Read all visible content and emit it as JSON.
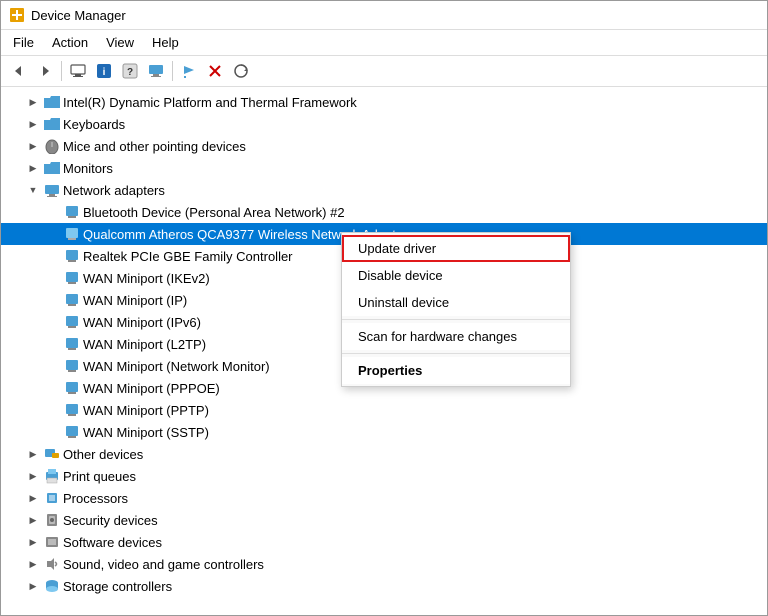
{
  "window": {
    "title": "Device Manager"
  },
  "menu": {
    "items": [
      "File",
      "Action",
      "View",
      "Help"
    ]
  },
  "toolbar": {
    "buttons": [
      {
        "name": "back",
        "icon": "◀",
        "disabled": false
      },
      {
        "name": "forward",
        "icon": "▶",
        "disabled": false
      },
      {
        "name": "computer",
        "icon": "🖥",
        "disabled": false
      },
      {
        "name": "info",
        "icon": "ℹ",
        "disabled": false
      },
      {
        "name": "help",
        "icon": "?",
        "disabled": false
      },
      {
        "name": "monitor",
        "icon": "🖥",
        "disabled": false
      },
      {
        "name": "flag",
        "icon": "⚑",
        "disabled": false
      },
      {
        "name": "delete",
        "icon": "✖",
        "disabled": false
      },
      {
        "name": "refresh",
        "icon": "⊕",
        "disabled": false
      }
    ]
  },
  "tree": {
    "items": [
      {
        "id": "intel",
        "label": "Intel(R) Dynamic Platform and Thermal Framework",
        "indent": 1,
        "icon": "folder",
        "expander": "collapsed"
      },
      {
        "id": "keyboards",
        "label": "Keyboards",
        "indent": 1,
        "icon": "folder",
        "expander": "collapsed"
      },
      {
        "id": "mice",
        "label": "Mice and other pointing devices",
        "indent": 1,
        "icon": "mouse",
        "expander": "collapsed"
      },
      {
        "id": "monitors",
        "label": "Monitors",
        "indent": 1,
        "icon": "folder",
        "expander": "collapsed"
      },
      {
        "id": "network",
        "label": "Network adapters",
        "indent": 1,
        "icon": "network",
        "expander": "expanded"
      },
      {
        "id": "bluetooth",
        "label": "Bluetooth Device (Personal Area Network) #2",
        "indent": 2,
        "icon": "network-device",
        "expander": "leaf"
      },
      {
        "id": "qualcomm",
        "label": "Qualcomm Atheros QCA9377 Wireless Network Adapter",
        "indent": 2,
        "icon": "network-device",
        "expander": "leaf",
        "selected": true
      },
      {
        "id": "realtek",
        "label": "Realtek PCIe GBE Family Controller",
        "indent": 2,
        "icon": "network-device",
        "expander": "leaf"
      },
      {
        "id": "wan-ikev2",
        "label": "WAN Miniport (IKEv2)",
        "indent": 2,
        "icon": "network-device",
        "expander": "leaf"
      },
      {
        "id": "wan-ip",
        "label": "WAN Miniport (IP)",
        "indent": 2,
        "icon": "network-device",
        "expander": "leaf"
      },
      {
        "id": "wan-ipv6",
        "label": "WAN Miniport (IPv6)",
        "indent": 2,
        "icon": "network-device",
        "expander": "leaf"
      },
      {
        "id": "wan-l2tp",
        "label": "WAN Miniport (L2TP)",
        "indent": 2,
        "icon": "network-device",
        "expander": "leaf"
      },
      {
        "id": "wan-nm",
        "label": "WAN Miniport (Network Monitor)",
        "indent": 2,
        "icon": "network-device",
        "expander": "leaf"
      },
      {
        "id": "wan-pppoe",
        "label": "WAN Miniport (PPPOE)",
        "indent": 2,
        "icon": "network-device",
        "expander": "leaf"
      },
      {
        "id": "wan-pptp",
        "label": "WAN Miniport (PPTP)",
        "indent": 2,
        "icon": "network-device",
        "expander": "leaf"
      },
      {
        "id": "wan-sstp",
        "label": "WAN Miniport (SSTP)",
        "indent": 2,
        "icon": "network-device",
        "expander": "leaf"
      },
      {
        "id": "other",
        "label": "Other devices",
        "indent": 1,
        "icon": "folder-device",
        "expander": "collapsed"
      },
      {
        "id": "print",
        "label": "Print queues",
        "indent": 1,
        "icon": "print",
        "expander": "collapsed"
      },
      {
        "id": "processors",
        "label": "Processors",
        "indent": 1,
        "icon": "folder",
        "expander": "collapsed"
      },
      {
        "id": "security",
        "label": "Security devices",
        "indent": 1,
        "icon": "security",
        "expander": "collapsed"
      },
      {
        "id": "software",
        "label": "Software devices",
        "indent": 1,
        "icon": "software",
        "expander": "collapsed"
      },
      {
        "id": "sound",
        "label": "Sound, video and game controllers",
        "indent": 1,
        "icon": "sound",
        "expander": "collapsed"
      },
      {
        "id": "storage",
        "label": "Storage controllers",
        "indent": 1,
        "icon": "storage",
        "expander": "collapsed"
      }
    ]
  },
  "context_menu": {
    "position_item_id": "qualcomm",
    "items": [
      {
        "id": "update-driver",
        "label": "Update driver",
        "highlighted": true,
        "bold": false
      },
      {
        "id": "disable-device",
        "label": "Disable device",
        "highlighted": false,
        "bold": false
      },
      {
        "id": "uninstall-device",
        "label": "Uninstall device",
        "highlighted": false,
        "bold": false
      },
      {
        "id": "sep1",
        "type": "separator"
      },
      {
        "id": "scan-changes",
        "label": "Scan for hardware changes",
        "highlighted": false,
        "bold": false
      },
      {
        "id": "sep2",
        "type": "separator"
      },
      {
        "id": "properties",
        "label": "Properties",
        "highlighted": false,
        "bold": true
      }
    ]
  }
}
